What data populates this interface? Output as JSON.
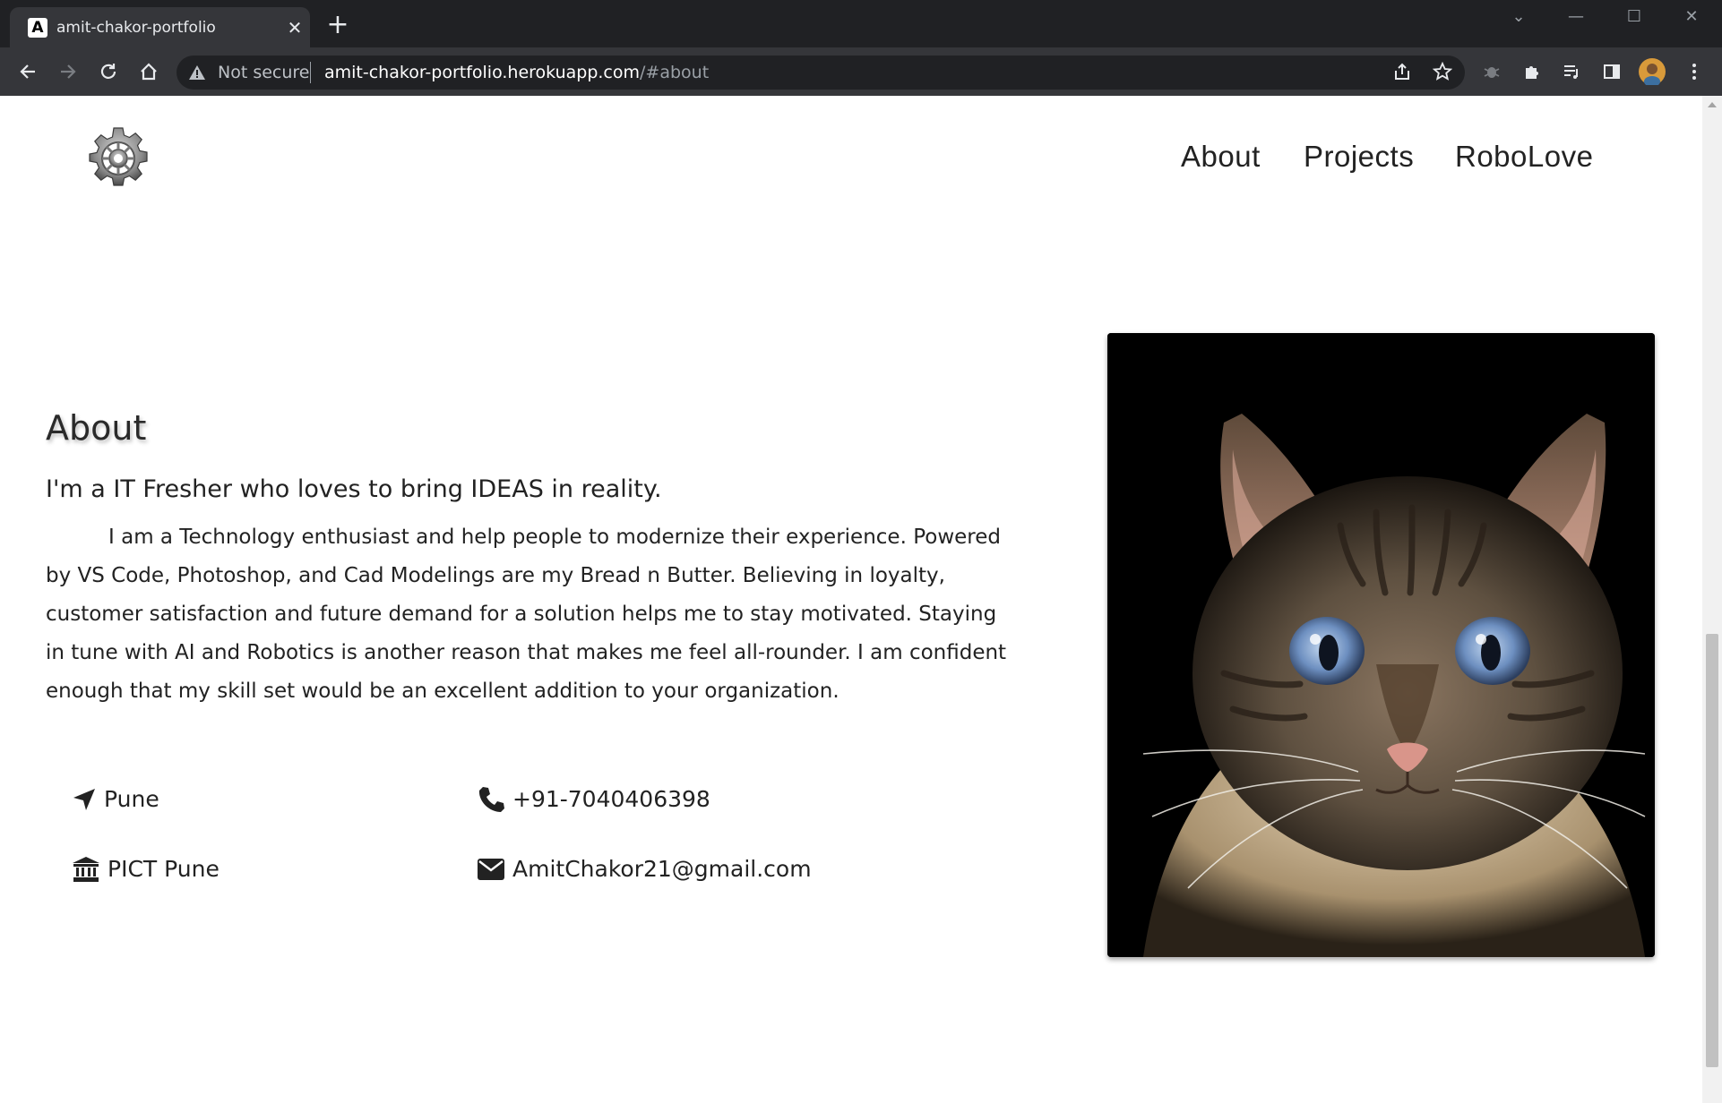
{
  "browser": {
    "tab_title": "amit-chakor-portfolio",
    "favicon_letter": "A",
    "security_label": "Not secure",
    "url_host": "amit-chakor-portfolio.herokuapp.com",
    "url_path": "/#about"
  },
  "nav": {
    "items": [
      {
        "label": "About"
      },
      {
        "label": "Projects"
      },
      {
        "label": "RoboLove"
      }
    ]
  },
  "about": {
    "title": "About",
    "subtitle": "I'm a IT Fresher who loves to bring IDEAS in reality.",
    "body": "I am a Technology enthusiast and help people to modernize their experience. Powered by VS Code, Photoshop, and Cad Modelings are my Bread n Butter. Believing in loyalty, customer satisfaction and future demand for a solution helps me to stay motivated. Staying in tune with AI and Robotics is another reason that makes me feel all-rounder. I am confident enough that my skill set would be an excellent addition to your organization.",
    "location": "Pune",
    "phone": "+91-7040406398",
    "college": "PICT Pune",
    "email": "AmitChakor21@gmail.com"
  },
  "icons": {
    "logo": "gear-icon",
    "location": "location-arrow-icon",
    "phone": "phone-icon",
    "college": "institution-icon",
    "email": "envelope-icon"
  }
}
